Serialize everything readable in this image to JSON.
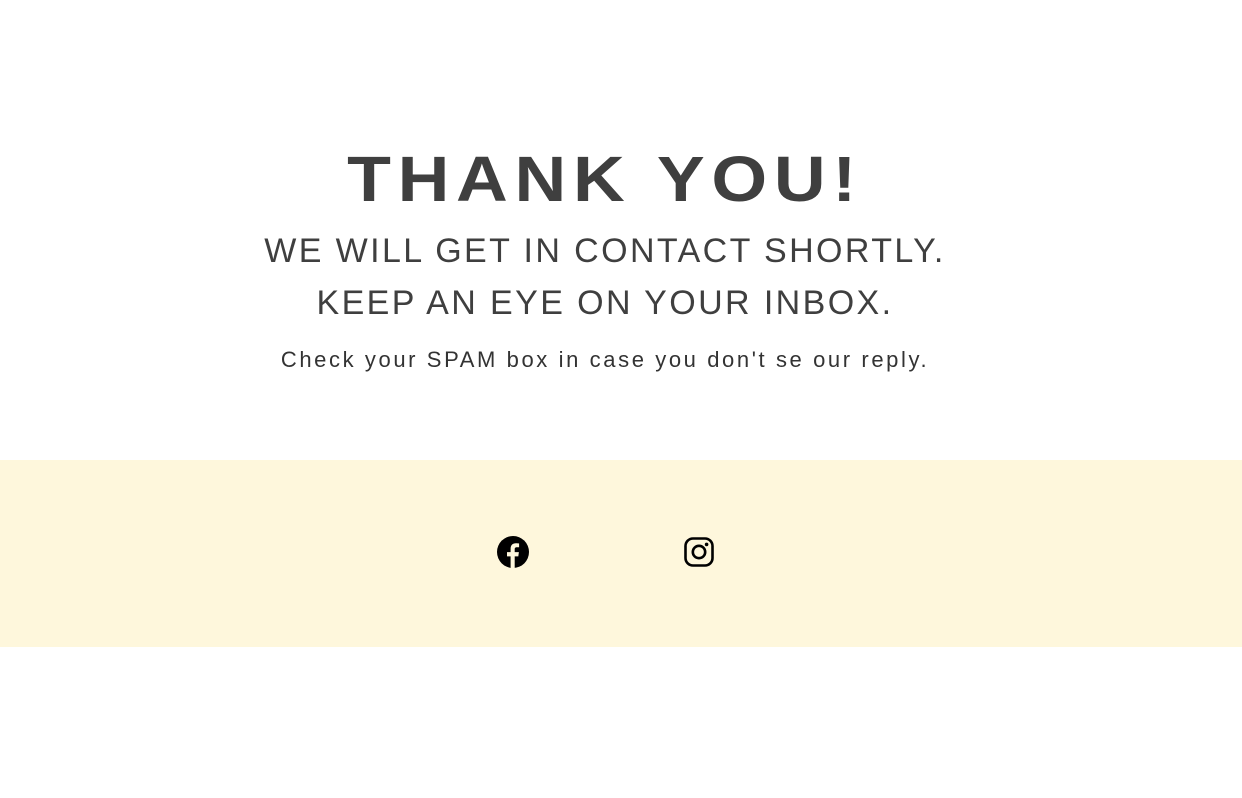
{
  "hero": {
    "title": "THANK YOU!",
    "line1": "WE WILL GET IN CONTACT SHORTLY.",
    "line2": "KEEP AN EYE ON YOUR INBOX.",
    "note": "Check your SPAM box in case you don't se our reply."
  },
  "footer": {
    "background": "#fef7dc",
    "social": [
      {
        "icon": "facebook-icon"
      },
      {
        "icon": "instagram-icon"
      }
    ]
  },
  "colors": {
    "text": "#3f3f3f",
    "icon": "#000000"
  }
}
